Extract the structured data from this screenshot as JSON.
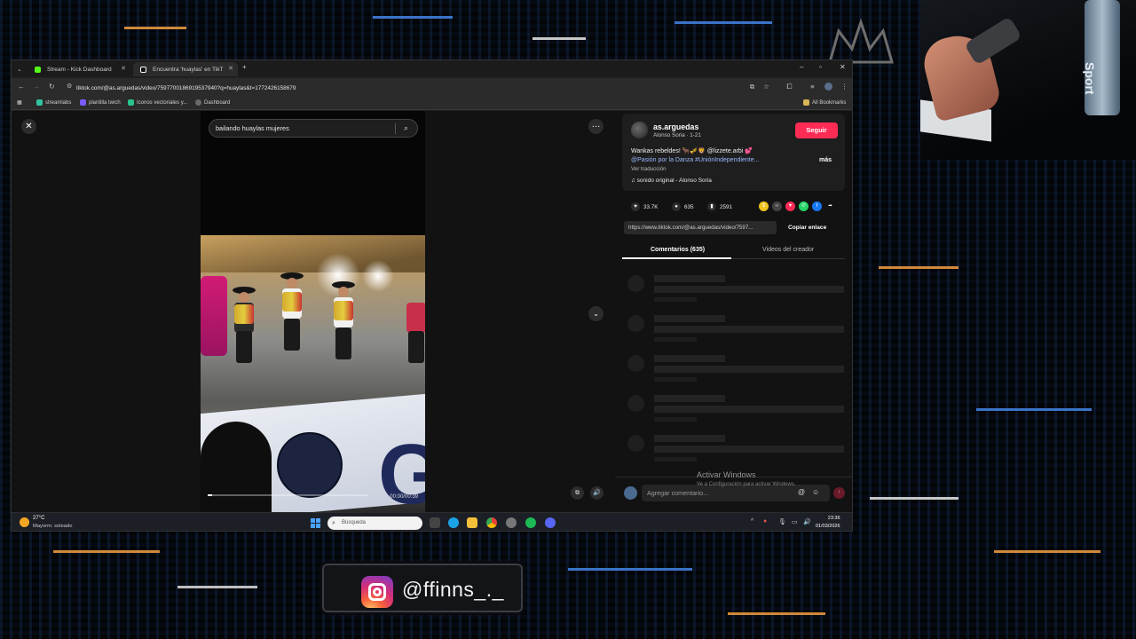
{
  "browser": {
    "tabs": [
      {
        "title": "Stream - Kick Dashboard",
        "favicon_color": "#53fc18"
      },
      {
        "title": "Encuentra 'huaylas' en TikT",
        "favicon_color": "#ffffff"
      }
    ],
    "url": "tiktok.com/@as.arguedas/video/7597700186919537940?q=huaylas&t=1772426158679",
    "bookmarks": [
      {
        "label": "streamlabs",
        "color": "#31c3a2"
      },
      {
        "label": "plantilla twich",
        "color": "#7a5cff"
      },
      {
        "label": "Iconos vectoriales y...",
        "color": "#28c28a"
      },
      {
        "label": "Dashboard",
        "color": "#6a6a6a"
      }
    ],
    "all_bookmarks": "All Bookmarks"
  },
  "video": {
    "search_text": "bailando huaylas mujeres",
    "time": "00:00/00:39",
    "progress_fraction": 0.03
  },
  "post": {
    "username": "as.arguedas",
    "subtitle": "Alonso Soria · 1-21",
    "follow_label": "Seguir",
    "description_line1": "Wankas rebeldes! 🐂🎺🦁 @lizzete.arbi 💕",
    "description_line2": "@Pasión por la Danza #UniónIndependiente...",
    "more_label": "más",
    "translate_label": "Ver traducción",
    "sound": "♫  sonido original - Alonso Soria",
    "likes": "33.7K",
    "comments": "635",
    "saves": "2591",
    "link": "https://www.tiktok.com/@as.arguedas/video/7597...",
    "copy_label": "Copiar enlace",
    "tab_comments": "Comentarios (635)",
    "tab_creator": "Videos del creador",
    "comment_placeholder": "Agregar comentario..."
  },
  "windows": {
    "activate_title": "Activar Windows",
    "activate_sub": "Ve a Configuración para activar Windows.",
    "temperature": "27°C",
    "weather": "Mayorm. soleado",
    "search_placeholder": "Búsqueda",
    "time": "23:36",
    "date": "01/03/2026"
  },
  "overlay": {
    "instagram_handle": "@ffinns_._",
    "webcam_bottle_text": "Sport"
  },
  "colors": {
    "tiktok_red": "#fe2c55",
    "instagram_gradient": [
      "#fdd170",
      "#f8623b",
      "#d62f7a",
      "#8a3ab9"
    ]
  }
}
